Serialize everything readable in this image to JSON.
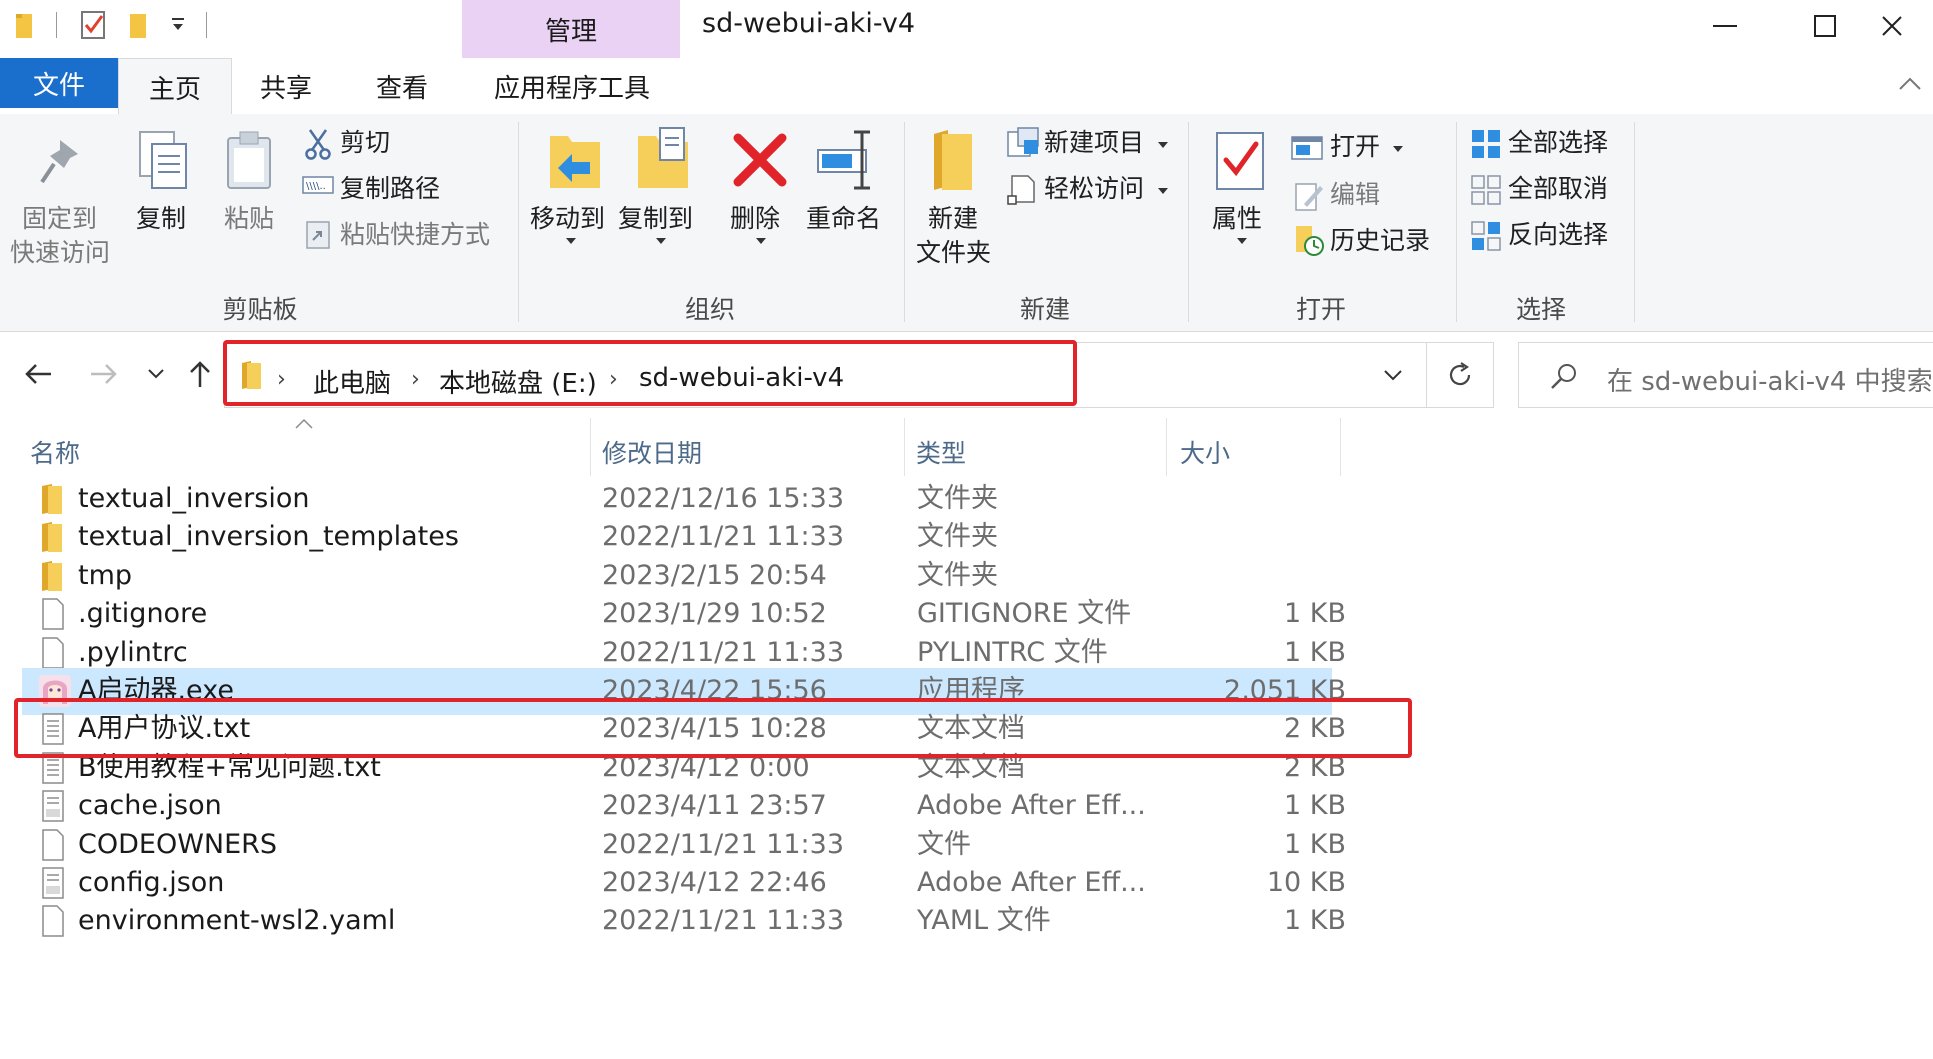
{
  "window": {
    "manage_tab": "管理",
    "title": "sd-webui-aki-v4"
  },
  "ribbon_tabs": {
    "file": "文件",
    "home": "主页",
    "share": "共享",
    "view": "查看",
    "app_tools": "应用程序工具"
  },
  "ribbon": {
    "clipboard": {
      "pin_line1": "固定到",
      "pin_line2": "快速访问",
      "copy": "复制",
      "paste": "粘贴",
      "cut": "剪切",
      "copy_path": "复制路径",
      "paste_shortcut": "粘贴快捷方式",
      "group": "剪贴板"
    },
    "organize": {
      "move_to": "移动到",
      "copy_to": "复制到",
      "delete": "删除",
      "rename": "重命名",
      "group": "组织"
    },
    "new": {
      "new_folder_line1": "新建",
      "new_folder_line2": "文件夹",
      "new_item": "新建项目",
      "easy_access": "轻松访问",
      "group": "新建"
    },
    "open": {
      "properties": "属性",
      "open": "打开",
      "edit": "编辑",
      "history": "历史记录",
      "group": "打开"
    },
    "select": {
      "select_all": "全部选择",
      "select_none": "全部取消",
      "invert": "反向选择",
      "group": "选择"
    }
  },
  "address": {
    "crumbs": [
      "此电脑",
      "本地磁盘 (E:)",
      "sd-webui-aki-v4"
    ],
    "search_placeholder": "在 sd-webui-aki-v4 中搜索"
  },
  "columns": {
    "name": "名称",
    "date": "修改日期",
    "type": "类型",
    "size": "大小"
  },
  "files": [
    {
      "name": "textual_inversion",
      "date": "2022/12/16 15:33",
      "type": "文件夹",
      "size": "",
      "icon": "folder-icon"
    },
    {
      "name": "textual_inversion_templates",
      "date": "2022/11/21 11:33",
      "type": "文件夹",
      "size": "",
      "icon": "folder-icon"
    },
    {
      "name": "tmp",
      "date": "2023/2/15 20:54",
      "type": "文件夹",
      "size": "",
      "icon": "folder-icon"
    },
    {
      "name": ".gitignore",
      "date": "2023/1/29 10:52",
      "type": "GITIGNORE 文件",
      "size": "1 KB",
      "icon": "file-icon"
    },
    {
      "name": ".pylintrc",
      "date": "2022/11/21 11:33",
      "type": "PYLINTRC 文件",
      "size": "1 KB",
      "icon": "file-icon"
    },
    {
      "name": "A启动器.exe",
      "date": "2023/4/22 15:56",
      "type": "应用程序",
      "size": "2,051 KB",
      "icon": "app-avatar-icon",
      "selected": true
    },
    {
      "name": "A用户协议.txt",
      "date": "2023/4/15 10:28",
      "type": "文本文档",
      "size": "2 KB",
      "icon": "text-file-icon"
    },
    {
      "name": "B使用教程+常见问题.txt",
      "date": "2023/4/12 0:00",
      "type": "文本文档",
      "size": "2 KB",
      "icon": "text-file-icon"
    },
    {
      "name": "cache.json",
      "date": "2023/4/11 23:57",
      "type": "Adobe After Eff...",
      "size": "1 KB",
      "icon": "json-file-icon"
    },
    {
      "name": "CODEOWNERS",
      "date": "2022/11/21 11:33",
      "type": "文件",
      "size": "1 KB",
      "icon": "file-icon"
    },
    {
      "name": "config.json",
      "date": "2023/4/12 22:46",
      "type": "Adobe After Eff...",
      "size": "10 KB",
      "icon": "json-file-icon"
    },
    {
      "name": "environment-wsl2.yaml",
      "date": "2022/11/21 11:33",
      "type": "YAML 文件",
      "size": "1 KB",
      "icon": "file-icon"
    }
  ],
  "colors": {
    "file_tab": "#1b6fcc",
    "manage_tab": "#e9d2f4",
    "selected_row": "#cce8ff",
    "highlight_box": "#e0242a"
  }
}
